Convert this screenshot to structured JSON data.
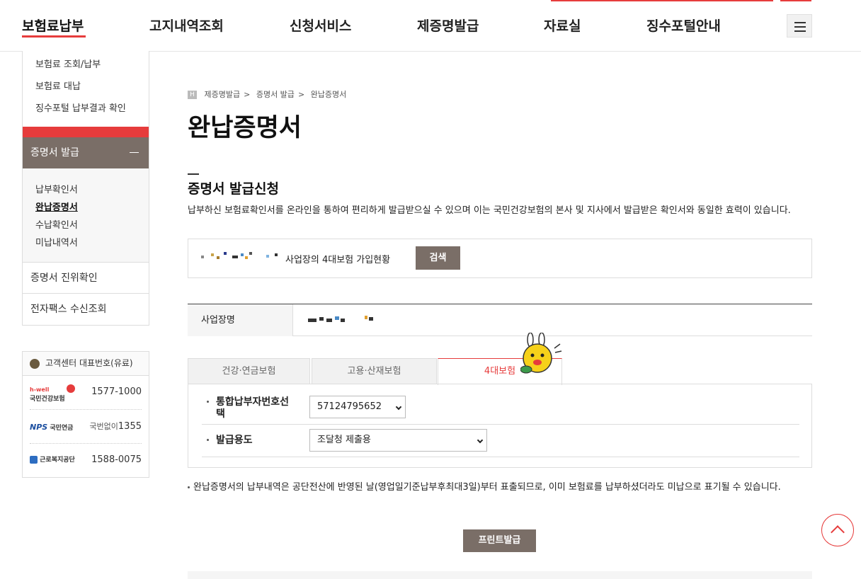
{
  "gnb": {
    "items": [
      "보험료납부",
      "고지내역조회",
      "신청서비스",
      "제증명발급",
      "자료실",
      "징수포털안내"
    ],
    "active_index": 0,
    "accent_color": "#e63c3c"
  },
  "lnb": {
    "sub_items": [
      "보험료 조회/납부",
      "보험료 대납",
      "징수포털 납부결과 확인"
    ],
    "active_label": "증명서 발급",
    "children": [
      "납부확인서",
      "완납증명서",
      "수납확인서",
      "미납내역서"
    ],
    "current_child": "완납증명서",
    "rows": [
      "증명서 진위확인",
      "전자팩스 수신조회"
    ]
  },
  "customer_center": {
    "title": "고객센터 대표번호(유료)",
    "entries": [
      {
        "org": "국민건강보험",
        "brand": "h-well",
        "number": "1577-1000",
        "prefix": ""
      },
      {
        "org": "국민연금",
        "brand": "NPS",
        "number": "1355",
        "prefix": "국번없이"
      },
      {
        "org": "근로복지공단",
        "brand": "",
        "number": "1588-0075",
        "prefix": ""
      }
    ]
  },
  "breadcrumb": {
    "home_label": "H",
    "items": [
      "제증명발급",
      "증명서 발급",
      "완납증명서"
    ]
  },
  "page": {
    "title": "완납증명서",
    "section_title": "증명서 발급신청",
    "description": "납부하신 보험료확인서를 온라인을 통하여 편리하게 발급받으실 수 있으며 이는 국민건강보험의 본사 및 지사에서 발급받은 확인서와 동일한 효력이 있습니다."
  },
  "search": {
    "text": "사업장의 4대보험 가입현황",
    "button_label": "검색"
  },
  "info": {
    "label": "사업장명"
  },
  "tabs": {
    "items": [
      "건강·연금보험",
      "고용·산재보험",
      "4대보험"
    ],
    "active_index": 2
  },
  "form": {
    "payer_label": "통합납부자번호선택",
    "payer_value": "57124795652",
    "purpose_label": "발급용도",
    "purpose_value": "조달청 제출용"
  },
  "note": "완납증명서의 납부내역은 공단전산에 반영된 날(영업일기준납부후최대3일)부터 표출되므로, 이미 보험료를 납부하셨더라도 미납으로 표기될 수 있습니다.",
  "print_button": "프린트발급",
  "colors": {
    "accent": "#e63c3c",
    "button_bg": "#7a6e67"
  }
}
